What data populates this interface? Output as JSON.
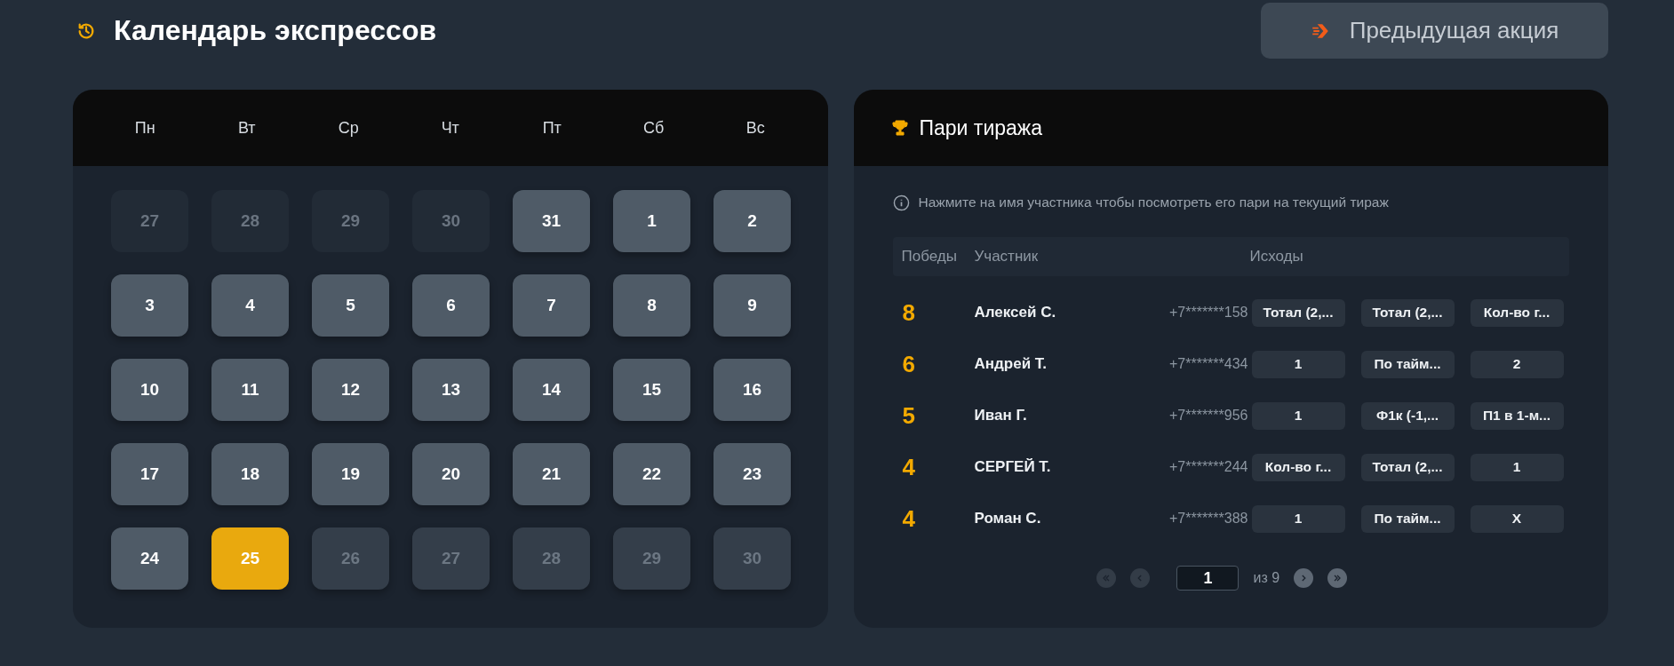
{
  "header": {
    "title": "Календарь экспрессов",
    "previous_button": "Предыдущая акция"
  },
  "calendar": {
    "weekdays": [
      "Пн",
      "Вт",
      "Ср",
      "Чт",
      "Пт",
      "Сб",
      "Вс"
    ],
    "days": [
      {
        "label": "27",
        "kind": "other",
        "selected": false
      },
      {
        "label": "28",
        "kind": "other",
        "selected": false
      },
      {
        "label": "29",
        "kind": "other",
        "selected": false
      },
      {
        "label": "30",
        "kind": "other",
        "selected": false
      },
      {
        "label": "31",
        "kind": "past",
        "selected": false
      },
      {
        "label": "1",
        "kind": "past",
        "selected": false
      },
      {
        "label": "2",
        "kind": "past",
        "selected": false
      },
      {
        "label": "3",
        "kind": "past",
        "selected": false
      },
      {
        "label": "4",
        "kind": "past",
        "selected": false
      },
      {
        "label": "5",
        "kind": "past",
        "selected": false
      },
      {
        "label": "6",
        "kind": "past",
        "selected": false
      },
      {
        "label": "7",
        "kind": "past",
        "selected": false
      },
      {
        "label": "8",
        "kind": "past",
        "selected": false
      },
      {
        "label": "9",
        "kind": "past",
        "selected": false
      },
      {
        "label": "10",
        "kind": "past",
        "selected": false
      },
      {
        "label": "11",
        "kind": "past",
        "selected": false
      },
      {
        "label": "12",
        "kind": "past",
        "selected": false
      },
      {
        "label": "13",
        "kind": "past",
        "selected": false
      },
      {
        "label": "14",
        "kind": "past",
        "selected": false
      },
      {
        "label": "15",
        "kind": "past",
        "selected": false
      },
      {
        "label": "16",
        "kind": "past",
        "selected": false
      },
      {
        "label": "17",
        "kind": "past",
        "selected": false
      },
      {
        "label": "18",
        "kind": "past",
        "selected": false
      },
      {
        "label": "19",
        "kind": "past",
        "selected": false
      },
      {
        "label": "20",
        "kind": "past",
        "selected": false
      },
      {
        "label": "21",
        "kind": "past",
        "selected": false
      },
      {
        "label": "22",
        "kind": "past",
        "selected": false
      },
      {
        "label": "23",
        "kind": "past",
        "selected": false
      },
      {
        "label": "24",
        "kind": "past",
        "selected": false
      },
      {
        "label": "25",
        "kind": "past",
        "selected": true
      },
      {
        "label": "26",
        "kind": "future",
        "selected": false
      },
      {
        "label": "27",
        "kind": "future",
        "selected": false
      },
      {
        "label": "28",
        "kind": "future",
        "selected": false
      },
      {
        "label": "29",
        "kind": "future",
        "selected": false
      },
      {
        "label": "30",
        "kind": "future",
        "selected": false
      }
    ]
  },
  "bets": {
    "title": "Пари тиража",
    "hint": "Нажмите на имя участника чтобы посмотреть его пари на текущий тираж",
    "columns": [
      "Победы",
      "Участник",
      "Исходы"
    ],
    "rows": [
      {
        "wins": "8",
        "name": "Алексей С.",
        "phone": "+7*******158",
        "outcomes": [
          "Тотал (2,...",
          "Тотал (2,...",
          "Кол-во г..."
        ]
      },
      {
        "wins": "6",
        "name": "Андрей Т.",
        "phone": "+7*******434",
        "outcomes": [
          "1",
          "По тайм...",
          "2"
        ]
      },
      {
        "wins": "5",
        "name": "Иван Г.",
        "phone": "+7*******956",
        "outcomes": [
          "1",
          "Ф1к (-1,...",
          "П1 в 1-м..."
        ]
      },
      {
        "wins": "4",
        "name": "СЕРГЕЙ Т.",
        "phone": "+7*******244",
        "outcomes": [
          "Кол-во г...",
          "Тотал (2,...",
          "1"
        ]
      },
      {
        "wins": "4",
        "name": "Роман С.",
        "phone": "+7*******388",
        "outcomes": [
          "1",
          "По тайм...",
          "X"
        ]
      }
    ],
    "pagination": {
      "page": "1",
      "of_label": "из 9",
      "first_disabled": true,
      "prev_disabled": true,
      "next_disabled": false,
      "last_disabled": false
    }
  }
}
